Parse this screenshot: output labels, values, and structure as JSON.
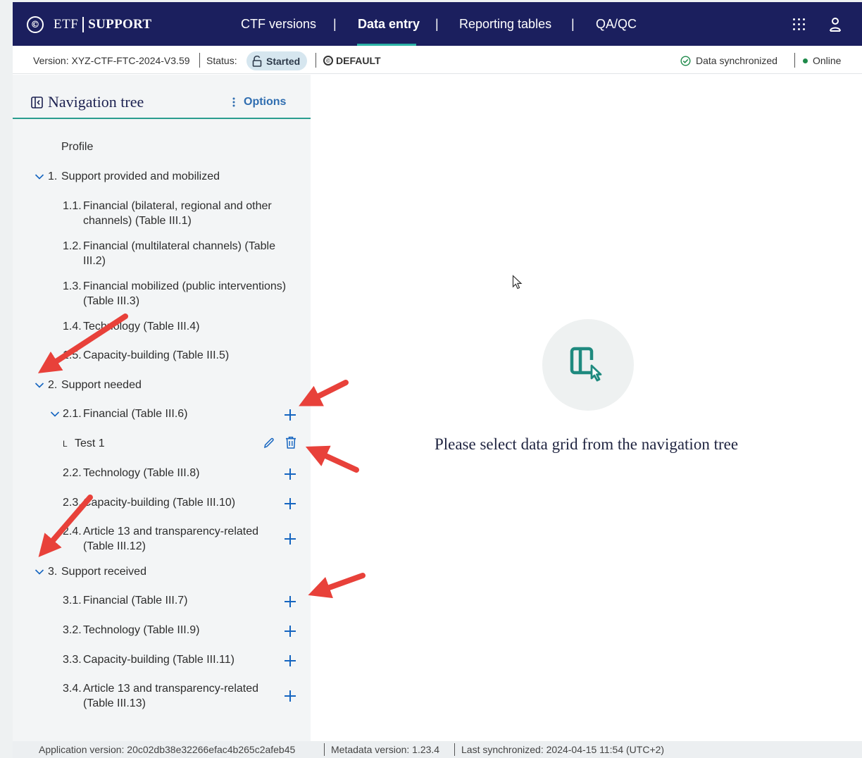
{
  "header": {
    "logo_symbol": "©",
    "logo_etf": "ETF",
    "logo_support": "SUPPORT",
    "nav": [
      {
        "label": "CTF versions"
      },
      {
        "label": "Data entry",
        "active": true
      },
      {
        "label": "Reporting tables"
      },
      {
        "label": "QA/QC"
      }
    ],
    "pipe": "|",
    "apps_icon": "apps-grid-icon",
    "user_icon": "user-icon"
  },
  "status_bar": {
    "version": "Version: XYZ-CTF-FTC-2024-V3.59",
    "status_label": "Status:",
    "status_value": "Started",
    "default_symbol": "©",
    "default_label": "DEFAULT",
    "sync_label": "Data synchronized",
    "online_label": "Online",
    "online_color": "#1e8a4a"
  },
  "nav_tree": {
    "title": "Navigation tree",
    "options_label": "Options",
    "items": [
      {
        "label": "Profile"
      },
      {
        "num": "1.",
        "label": "Support provided and mobilized"
      },
      {
        "num": "1.1.",
        "label": "Financial (bilateral, regional and other",
        "label2": "channels) (Table III.1)"
      },
      {
        "num": "1.2.",
        "label": "Financial (multilateral channels) (Table",
        "label2": "III.2)"
      },
      {
        "num": "1.3.",
        "label": "Financial mobilized (public interventions)",
        "label2": "(Table III.3)"
      },
      {
        "num": "1.4.",
        "label": "Technology (Table III.4)"
      },
      {
        "num": "1.5.",
        "label": "Capacity-building (Table III.5)"
      },
      {
        "num": "2.",
        "label": "Support needed"
      },
      {
        "num": "2.1.",
        "label": "Financial (Table III.6)"
      },
      {
        "num": "L",
        "label": "Test 1"
      },
      {
        "num": "2.2.",
        "label": "Technology (Table III.8)"
      },
      {
        "num": "2.3.",
        "label": "Capacity-building (Table III.10)"
      },
      {
        "num": "2.4.",
        "label": "Article 13 and transparency-related",
        "label2": "(Table III.12)"
      },
      {
        "num": "3.",
        "label": "Support received"
      },
      {
        "num": "3.1.",
        "label": "Financial (Table III.7)"
      },
      {
        "num": "3.2.",
        "label": "Technology (Table III.9)"
      },
      {
        "num": "3.3.",
        "label": "Capacity-building (Table III.11)"
      },
      {
        "num": "3.4.",
        "label": "Article 13 and transparency-related",
        "label2": "(Table III.13)"
      }
    ]
  },
  "main": {
    "empty_message": "Please select data grid from the navigation tree",
    "empty_icon": "select-panel-icon"
  },
  "footer": {
    "app_version": "Application version: 20c02db38e32266efac4b265c2afeb45",
    "metadata_version": "Metadata version: 1.23.4",
    "last_sync": "Last synchronized: 2024-04-15 11:54 (UTC+2)"
  },
  "colors": {
    "header_bg": "#1b1f5e",
    "accent_teal": "#2a9d8f",
    "link_blue": "#2f6db0",
    "annotation_red": "#e8413a"
  }
}
